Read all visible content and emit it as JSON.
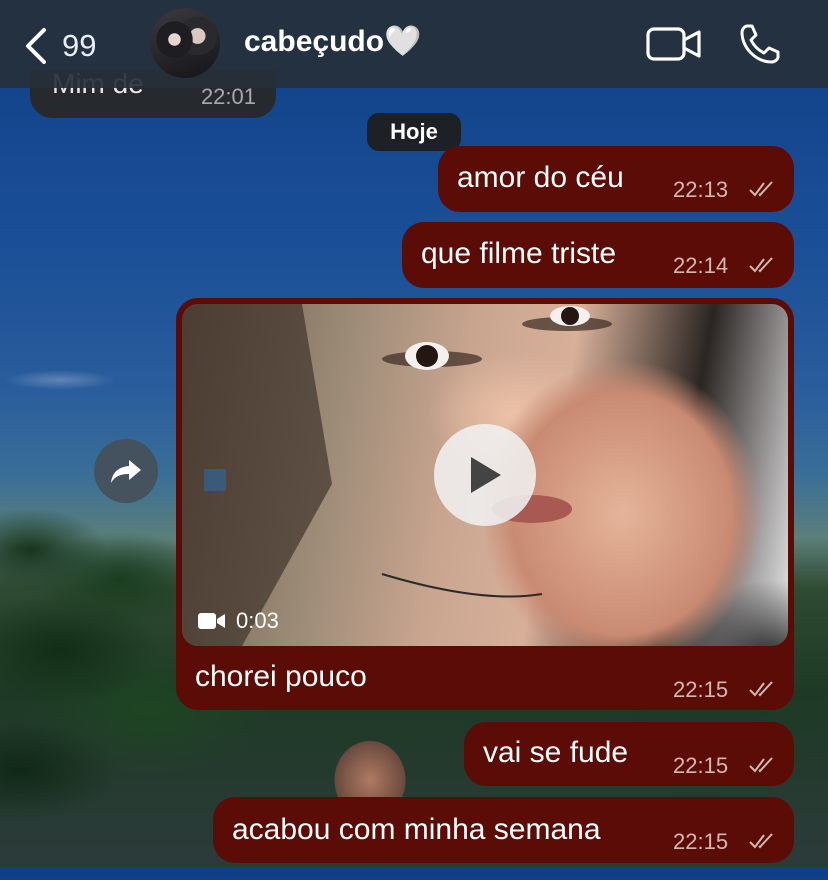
{
  "header": {
    "back_count": "99",
    "contact_name": "cabeçudo🤍"
  },
  "incoming": {
    "text": "Mim de",
    "time": "22:01"
  },
  "date_separator": "Hoje",
  "messages": [
    {
      "text": "amor do céu",
      "time": "22:13"
    },
    {
      "text": "que filme triste",
      "time": "22:14"
    },
    {
      "text": "chorei pouco",
      "time": "22:15",
      "video_duration": "0:03"
    },
    {
      "text": "vai se fude",
      "time": "22:15"
    },
    {
      "text": "acabou com minha semana",
      "time": "22:15"
    }
  ],
  "colors": {
    "outgoing_bubble": "#5c0c06",
    "header_bg": "#26303a"
  },
  "icons": [
    "chevron-left-icon",
    "video-camera-icon",
    "phone-icon",
    "forward-icon",
    "play-icon",
    "double-check-icon"
  ]
}
